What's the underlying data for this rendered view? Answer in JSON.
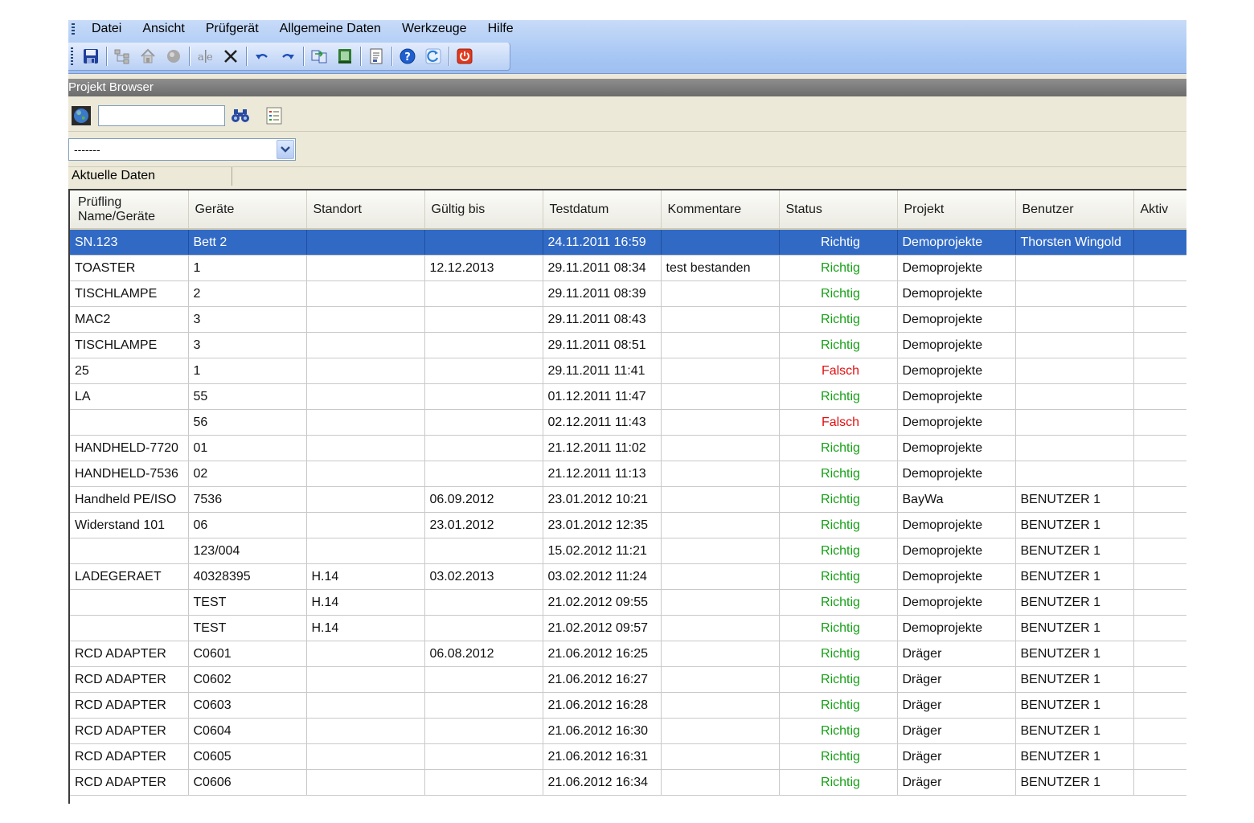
{
  "menu": {
    "items": [
      "Datei",
      "Ansicht",
      "Prüfgerät",
      "Allgemeine Daten",
      "Werkzeuge",
      "Hilfe"
    ]
  },
  "panel": {
    "title": "Projekt Browser"
  },
  "search": {
    "value": "",
    "placeholder": ""
  },
  "filter": {
    "selected": "-------"
  },
  "tab": {
    "label": "Aktuelle Daten"
  },
  "colors": {
    "status_ok": "#18a018",
    "status_bad": "#e01010",
    "selection": "#316ac5"
  },
  "table": {
    "headers": [
      "Prüfling\nName/Geräte",
      "Geräte",
      "Standort",
      "Gültig bis",
      "Testdatum",
      "Kommentare",
      "Status",
      "Projekt",
      "Benutzer",
      "Aktiv"
    ],
    "rows": [
      {
        "name": "SN.123",
        "geraete": "Bett 2",
        "standort": "",
        "gueltig": "",
        "testdatum": "24.11.2011 16:59",
        "kommentare": "",
        "status": "Richtig",
        "projekt": "Demoprojekte",
        "benutzer": "Thorsten Wingold",
        "aktiv": "",
        "selected": true
      },
      {
        "name": "TOASTER",
        "geraete": "1",
        "standort": "",
        "gueltig": "12.12.2013",
        "testdatum": "29.11.2011 08:34",
        "kommentare": "test bestanden",
        "status": "Richtig",
        "projekt": "Demoprojekte",
        "benutzer": "",
        "aktiv": ""
      },
      {
        "name": "TISCHLAMPE",
        "geraete": "2",
        "standort": "",
        "gueltig": "",
        "testdatum": "29.11.2011 08:39",
        "kommentare": "",
        "status": "Richtig",
        "projekt": "Demoprojekte",
        "benutzer": "",
        "aktiv": ""
      },
      {
        "name": "MAC2",
        "geraete": "3",
        "standort": "",
        "gueltig": "",
        "testdatum": "29.11.2011 08:43",
        "kommentare": "",
        "status": "Richtig",
        "projekt": "Demoprojekte",
        "benutzer": "",
        "aktiv": ""
      },
      {
        "name": "TISCHLAMPE",
        "geraete": "3",
        "standort": "",
        "gueltig": "",
        "testdatum": "29.11.2011 08:51",
        "kommentare": "",
        "status": "Richtig",
        "projekt": "Demoprojekte",
        "benutzer": "",
        "aktiv": ""
      },
      {
        "name": "25",
        "geraete": "1",
        "standort": "",
        "gueltig": "",
        "testdatum": "29.11.2011 11:41",
        "kommentare": "",
        "status": "Falsch",
        "projekt": "Demoprojekte",
        "benutzer": "",
        "aktiv": ""
      },
      {
        "name": "LA",
        "geraete": "55",
        "standort": "",
        "gueltig": "",
        "testdatum": "01.12.2011 11:47",
        "kommentare": "",
        "status": "Richtig",
        "projekt": "Demoprojekte",
        "benutzer": "",
        "aktiv": ""
      },
      {
        "name": "",
        "geraete": "56",
        "standort": "",
        "gueltig": "",
        "testdatum": "02.12.2011 11:43",
        "kommentare": "",
        "status": "Falsch",
        "projekt": "Demoprojekte",
        "benutzer": "",
        "aktiv": ""
      },
      {
        "name": "HANDHELD-7720",
        "geraete": "01",
        "standort": "",
        "gueltig": "",
        "testdatum": "21.12.2011 11:02",
        "kommentare": "",
        "status": "Richtig",
        "projekt": "Demoprojekte",
        "benutzer": "",
        "aktiv": ""
      },
      {
        "name": "HANDHELD-7536",
        "geraete": "02",
        "standort": "",
        "gueltig": "",
        "testdatum": "21.12.2011 11:13",
        "kommentare": "",
        "status": "Richtig",
        "projekt": "Demoprojekte",
        "benutzer": "",
        "aktiv": ""
      },
      {
        "name": "Handheld PE/ISO",
        "geraete": "7536",
        "standort": "",
        "gueltig": "06.09.2012",
        "testdatum": "23.01.2012 10:21",
        "kommentare": "",
        "status": "Richtig",
        "projekt": "BayWa",
        "benutzer": "BENUTZER  1",
        "aktiv": ""
      },
      {
        "name": "Widerstand 101",
        "geraete": "06",
        "standort": "",
        "gueltig": "23.01.2012",
        "testdatum": "23.01.2012 12:35",
        "kommentare": "",
        "status": "Richtig",
        "projekt": "Demoprojekte",
        "benutzer": "BENUTZER  1",
        "aktiv": ""
      },
      {
        "name": "",
        "geraete": "123/004",
        "standort": "",
        "gueltig": "",
        "testdatum": "15.02.2012 11:21",
        "kommentare": "",
        "status": "Richtig",
        "projekt": "Demoprojekte",
        "benutzer": "BENUTZER  1",
        "aktiv": ""
      },
      {
        "name": "LADEGERAET",
        "geraete": "40328395",
        "standort": "H.14",
        "gueltig": "03.02.2013",
        "testdatum": "03.02.2012 11:24",
        "kommentare": "",
        "status": "Richtig",
        "projekt": "Demoprojekte",
        "benutzer": "BENUTZER  1",
        "aktiv": ""
      },
      {
        "name": "",
        "geraete": "TEST",
        "standort": "H.14",
        "gueltig": "",
        "testdatum": "21.02.2012 09:55",
        "kommentare": "",
        "status": "Richtig",
        "projekt": "Demoprojekte",
        "benutzer": "BENUTZER  1",
        "aktiv": ""
      },
      {
        "name": "",
        "geraete": "TEST",
        "standort": "H.14",
        "gueltig": "",
        "testdatum": "21.02.2012 09:57",
        "kommentare": "",
        "status": "Richtig",
        "projekt": "Demoprojekte",
        "benutzer": "BENUTZER  1",
        "aktiv": ""
      },
      {
        "name": "RCD ADAPTER",
        "geraete": "C0601",
        "standort": "",
        "gueltig": "06.08.2012",
        "testdatum": "21.06.2012 16:25",
        "kommentare": "",
        "status": "Richtig",
        "projekt": "Dräger",
        "benutzer": "BENUTZER  1",
        "aktiv": ""
      },
      {
        "name": "RCD ADAPTER",
        "geraete": "C0602",
        "standort": "",
        "gueltig": "",
        "testdatum": "21.06.2012 16:27",
        "kommentare": "",
        "status": "Richtig",
        "projekt": "Dräger",
        "benutzer": "BENUTZER  1",
        "aktiv": ""
      },
      {
        "name": "RCD ADAPTER",
        "geraete": "C0603",
        "standort": "",
        "gueltig": "",
        "testdatum": "21.06.2012 16:28",
        "kommentare": "",
        "status": "Richtig",
        "projekt": "Dräger",
        "benutzer": "BENUTZER  1",
        "aktiv": ""
      },
      {
        "name": "RCD ADAPTER",
        "geraete": "C0604",
        "standort": "",
        "gueltig": "",
        "testdatum": "21.06.2012 16:30",
        "kommentare": "",
        "status": "Richtig",
        "projekt": "Dräger",
        "benutzer": "BENUTZER  1",
        "aktiv": ""
      },
      {
        "name": "RCD ADAPTER",
        "geraete": "C0605",
        "standort": "",
        "gueltig": "",
        "testdatum": "21.06.2012 16:31",
        "kommentare": "",
        "status": "Richtig",
        "projekt": "Dräger",
        "benutzer": "BENUTZER  1",
        "aktiv": ""
      },
      {
        "name": "RCD ADAPTER",
        "geraete": "C0606",
        "standort": "",
        "gueltig": "",
        "testdatum": "21.06.2012 16:34",
        "kommentare": "",
        "status": "Richtig",
        "projekt": "Dräger",
        "benutzer": "BENUTZER  1",
        "aktiv": ""
      }
    ]
  }
}
